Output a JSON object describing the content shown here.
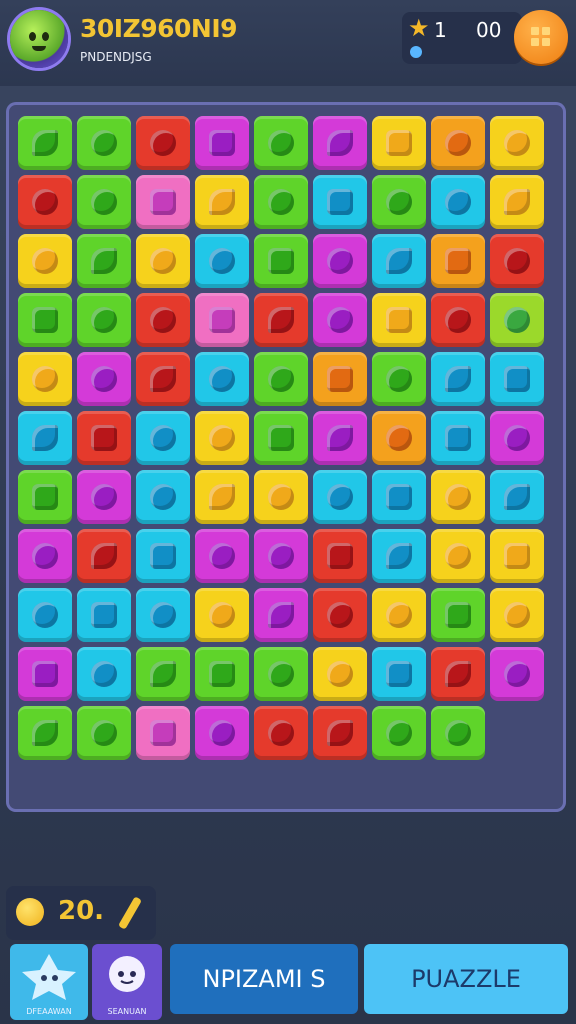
{
  "header": {
    "title": "30IZ960NI9",
    "subtitle": "PNDENDJSG",
    "stars": "1",
    "coins": "00"
  },
  "board": {
    "rows": 11,
    "cols": 9,
    "colors": {
      "green": "#5fd42a",
      "red": "#e53a2c",
      "yellow": "#f6d21c",
      "magenta": "#d43ad8",
      "cyan": "#21c7e8",
      "orange": "#f4a11d",
      "lime": "#9bd92b",
      "pink": "#f06fc2"
    },
    "tiles": [
      [
        "green",
        "green",
        "red",
        "magenta",
        "green",
        "magenta",
        "yellow",
        "orange",
        "yellow"
      ],
      [
        "red",
        "green",
        "pink",
        "yellow",
        "green",
        "cyan",
        "green",
        "cyan",
        "yellow"
      ],
      [
        "yellow",
        "green",
        "yellow",
        "cyan",
        "green",
        "magenta",
        "cyan",
        "orange",
        "red"
      ],
      [
        "green",
        "green",
        "red",
        "pink",
        "red",
        "magenta",
        "yellow",
        "red",
        "lime"
      ],
      [
        "yellow",
        "magenta",
        "red",
        "cyan",
        "green",
        "orange",
        "green",
        "cyan",
        "cyan"
      ],
      [
        "cyan",
        "red",
        "cyan",
        "yellow",
        "green",
        "magenta",
        "orange",
        "cyan",
        "magenta"
      ],
      [
        "green",
        "magenta",
        "cyan",
        "yellow",
        "yellow",
        "cyan",
        "cyan",
        "yellow",
        "cyan"
      ],
      [
        "magenta",
        "red",
        "cyan",
        "magenta",
        "magenta",
        "red",
        "cyan",
        "yellow",
        "yellow"
      ],
      [
        "cyan",
        "cyan",
        "cyan",
        "yellow",
        "magenta",
        "red",
        "yellow",
        "green",
        "yellow"
      ],
      [
        "magenta",
        "cyan",
        "green",
        "green",
        "green",
        "yellow",
        "cyan",
        "red",
        "magenta"
      ],
      [
        "green",
        "green",
        "pink",
        "magenta",
        "red",
        "red",
        "green",
        "green",
        null
      ]
    ]
  },
  "bottom": {
    "moves": "20.",
    "tab1_label": "DFEAAWAN",
    "tab2_label": "SEANUAN",
    "button1": "NPIZAMI S",
    "button2": "PUAZZLE"
  }
}
